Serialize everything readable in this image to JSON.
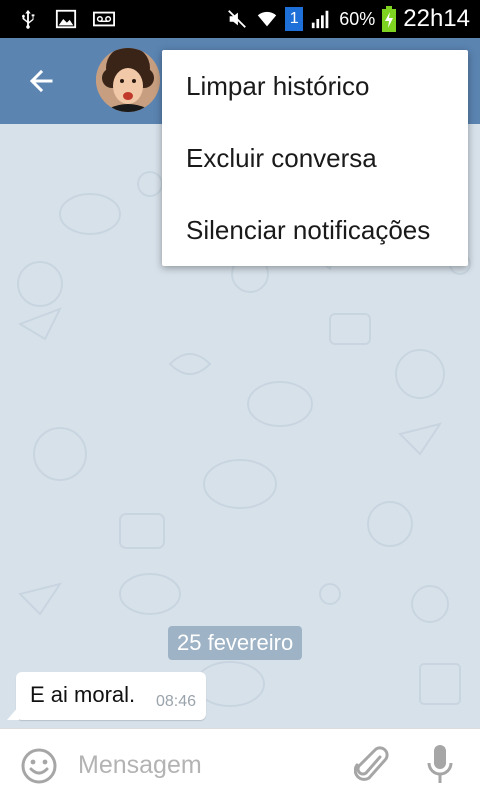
{
  "statusbar": {
    "battery": "60%",
    "time": "22h14",
    "sim_badge": "1"
  },
  "header": {
    "back_icon": "arrow-left-icon"
  },
  "menu": {
    "items": [
      {
        "label": "Limpar histórico"
      },
      {
        "label": "Excluir conversa"
      },
      {
        "label": "Silenciar notificações"
      }
    ]
  },
  "chat": {
    "date_divider": "25 fevereiro",
    "messages": [
      {
        "text": "E ai moral.",
        "time": "08:46"
      }
    ]
  },
  "composer": {
    "placeholder": "Mensagem"
  },
  "colors": {
    "header": "#5b84b1",
    "chat_background": "#d7e1ea",
    "date_chip": "#8ea8c0"
  }
}
